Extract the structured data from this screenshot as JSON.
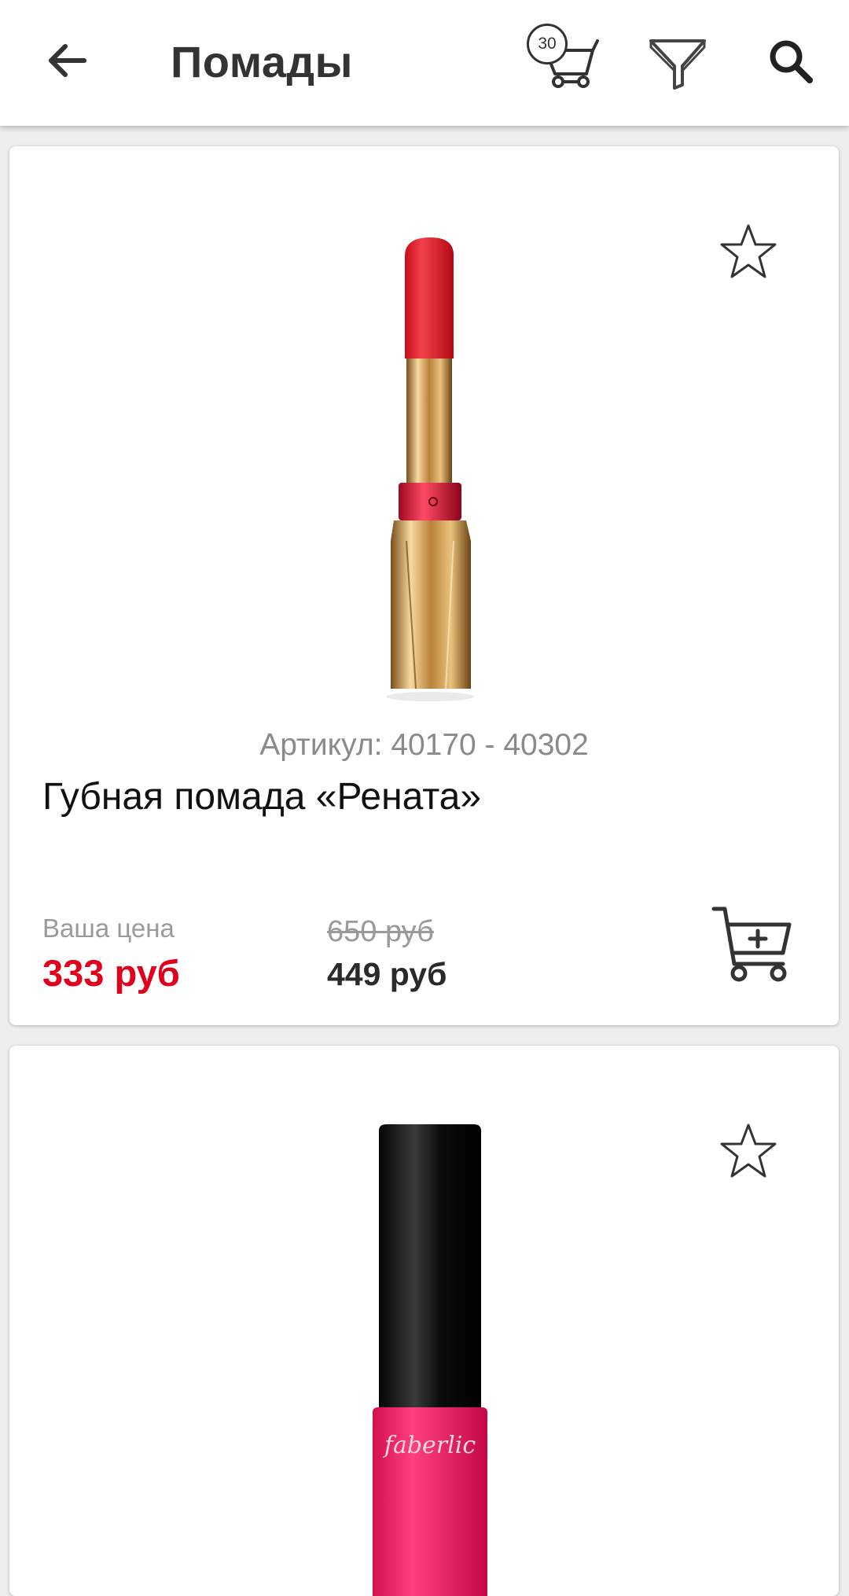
{
  "app_bar": {
    "title": "Помады",
    "cart_count": "30",
    "icons": {
      "back": "arrow-left-icon",
      "cart": "shopping-cart-icon",
      "filter": "funnel-filter-icon",
      "search": "magnifier-search-icon"
    }
  },
  "currency_note": "руб",
  "products": [
    {
      "sku": "Артикул: 40170 - 40302",
      "name": "Губная помада «Рената»",
      "your_price_label": "Ваша цена",
      "your_price": "333 руб",
      "old_price": "650 руб",
      "regular_price": "449 руб",
      "favorite": false,
      "icons": {
        "favorite": "star-outline-icon",
        "add_to_cart": "cart-plus-icon"
      }
    },
    {
      "brand_on_image": "faberlic",
      "favorite": false,
      "icons": {
        "favorite": "star-outline-icon"
      }
    }
  ],
  "colors": {
    "accent_red": "#e0001b",
    "appbar_bg": "#ffffff",
    "page_bg": "#eeeeee",
    "muted_text": "#9a9a9a"
  }
}
